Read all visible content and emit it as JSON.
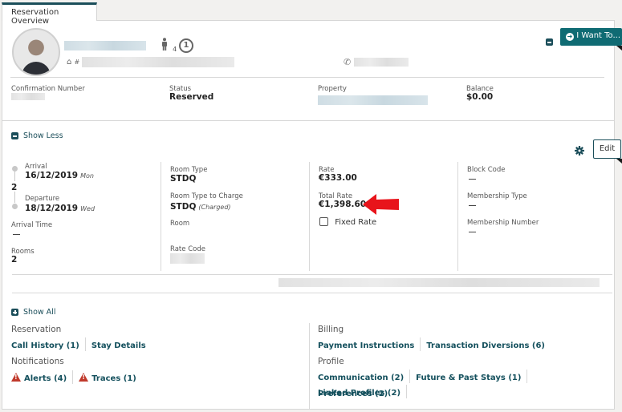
{
  "tab": {
    "label": "Reservation Overview"
  },
  "guest": {
    "adults_count": "4",
    "notification_count": "1",
    "address_prefix": "#"
  },
  "header_actions": {
    "i_want_to_label": "I Want To..."
  },
  "summary": {
    "confirmation_label": "Confirmation Number",
    "status_label": "Status",
    "status_value": "Reserved",
    "property_label": "Property",
    "balance_label": "Balance",
    "balance_value": "$0.00"
  },
  "details": {
    "show_less_label": "Show Less",
    "edit_label": "Edit",
    "arrival_label": "Arrival",
    "arrival_date": "16/12/2019",
    "arrival_day": "Mon",
    "nights": "2",
    "departure_label": "Departure",
    "departure_date": "18/12/2019",
    "departure_day": "Wed",
    "arrival_time_label": "Arrival Time",
    "rooms_label": "Rooms",
    "rooms_value": "2",
    "room_type_label": "Room Type",
    "room_type_value": "STDQ",
    "room_type_charge_label": "Room Type to Charge",
    "room_type_charge_value": "STDQ",
    "room_type_charge_note": "(Charged)",
    "room_label": "Room",
    "rate_code_label": "Rate Code",
    "rate_label": "Rate",
    "rate_value": "€333.00",
    "total_rate_label": "Total Rate",
    "total_rate_value": "€1,398.60",
    "fixed_rate_label": "Fixed Rate",
    "block_code_label": "Block Code",
    "membership_type_label": "Membership Type",
    "membership_number_label": "Membership Number"
  },
  "links": {
    "show_all_label": "Show All",
    "reservation_title": "Reservation",
    "call_history": "Call History (1)",
    "stay_details": "Stay Details",
    "notifications_title": "Notifications",
    "alerts": "Alerts (4)",
    "traces": "Traces (1)",
    "billing_title": "Billing",
    "payment_instructions": "Payment Instructions",
    "transaction_diversions": "Transaction Diversions (6)",
    "profile_title": "Profile",
    "communication": "Communication (2)",
    "future_past_stays": "Future & Past Stays (1)",
    "linked_profiles": "Linked Profiles (2)",
    "preferences": "Preferences (2)"
  },
  "colors": {
    "accent": "#1b4e5a",
    "button": "#0f6b73",
    "alert": "#c0392b",
    "annotation_arrow": "#e8141b"
  }
}
